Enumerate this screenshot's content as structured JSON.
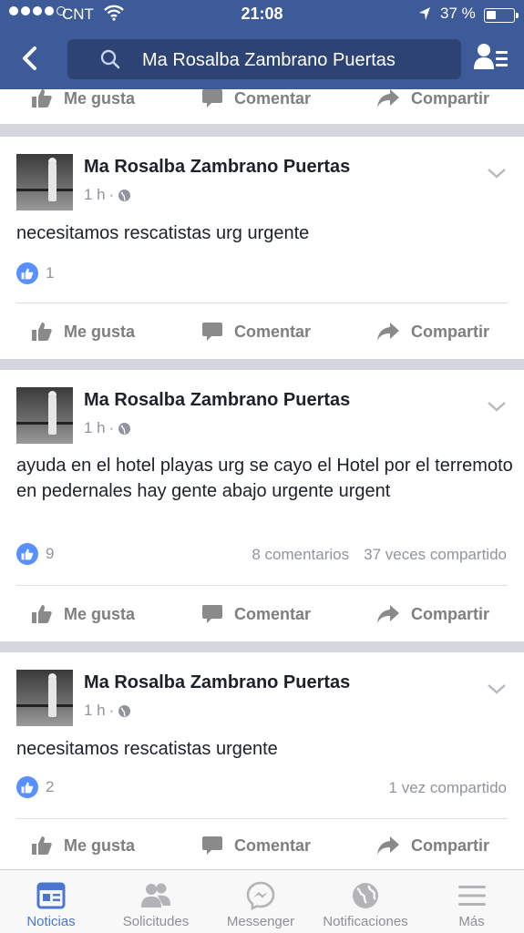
{
  "status_bar": {
    "carrier": "CNT",
    "time": "21:08",
    "battery": "37 %",
    "battery_level": 0.37
  },
  "search": {
    "query": "Ma Rosalba Zambrano Puertas"
  },
  "actions": {
    "like": "Me gusta",
    "comment": "Comentar",
    "share": "Compartir"
  },
  "posts": [
    {
      "author": "Ma Rosalba Zambrano Puertas",
      "time": "1 h",
      "separator": "·",
      "text": "necesitamos rescatistas urg urgente",
      "likes": "1",
      "comments": "",
      "shares": ""
    },
    {
      "author": "Ma Rosalba Zambrano Puertas",
      "time": "1 h",
      "separator": "·",
      "text": "ayuda en el hotel playas urg se cayo el Hotel por el terremoto en pedernales hay gente abajo urgente urgent",
      "likes": "9",
      "comments": "8 comentarios",
      "shares": "37 veces compartido"
    },
    {
      "author": "Ma Rosalba Zambrano Puertas",
      "time": "1 h",
      "separator": "·",
      "text": "necesitamos rescatistas urgente",
      "likes": "2",
      "comments": "",
      "shares": "1 vez compartido"
    }
  ],
  "tabs": [
    {
      "label": "Noticias",
      "icon": "news-feed-icon",
      "active": true
    },
    {
      "label": "Solicitudes",
      "icon": "friend-requests-icon",
      "active": false
    },
    {
      "label": "Messenger",
      "icon": "messenger-icon",
      "active": false
    },
    {
      "label": "Notificaciones",
      "icon": "globe-icon",
      "active": false
    },
    {
      "label": "Más",
      "icon": "menu-icon",
      "active": false
    }
  ],
  "colors": {
    "header": "#3d5a99",
    "accent": "#4a76d0",
    "like_badge": "#5890ff"
  }
}
